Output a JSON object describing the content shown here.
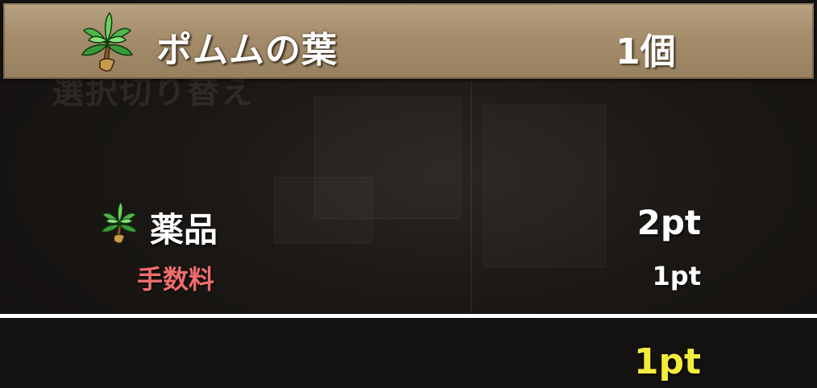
{
  "header": {
    "item_name": "ポムムの葉",
    "item_count": "1個",
    "item_icon": "leaf-bundle-icon"
  },
  "background": {
    "ghost_text": "選択切り替え"
  },
  "details": {
    "category": {
      "label": "薬品",
      "value": "2pt",
      "icon": "leaf-bundle-icon"
    },
    "fee": {
      "label": "手数料",
      "value": "1pt"
    },
    "total": {
      "value": "1pt"
    }
  },
  "colors": {
    "header_bar": "#a58d6b",
    "fee_label": "#f06d6d",
    "total_value": "#f4ec3c",
    "text": "#ffffff"
  }
}
